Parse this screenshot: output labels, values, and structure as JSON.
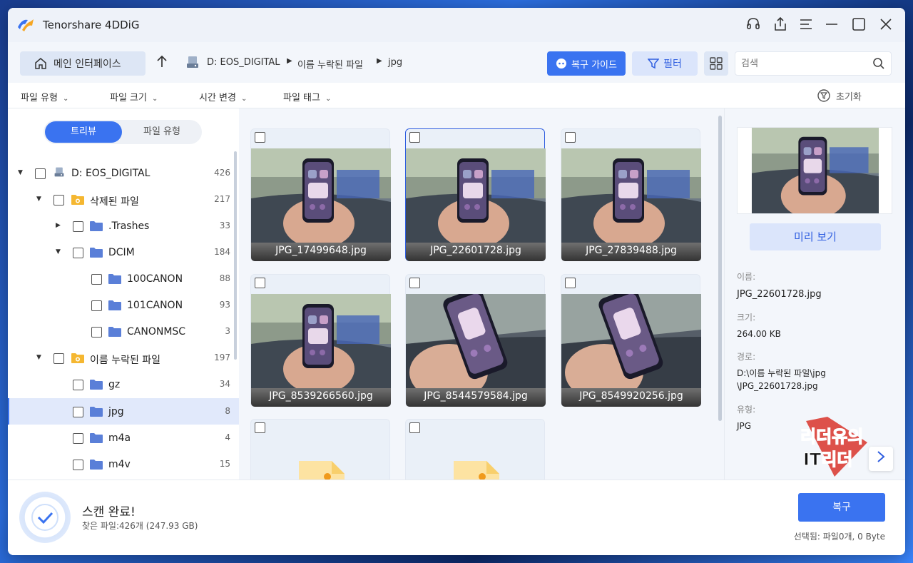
{
  "app": {
    "title": "Tenorshare 4DDiG"
  },
  "nav": {
    "home_label": "메인 인터페이스",
    "breadcrumb": [
      "D: EOS_DIGITAL",
      "이름 누락된 파일",
      "jpg"
    ],
    "guide_label": "복구 가이드",
    "filter_label": "필터",
    "search_placeholder": "검색"
  },
  "filters": {
    "items": [
      "파일 유형",
      "파일 크기",
      "시간 변경",
      "파일 태그"
    ],
    "reset_label": "초기화"
  },
  "sidebar": {
    "tabs": {
      "tree": "트리뷰",
      "type": "파일 유형"
    },
    "tree": [
      {
        "label": "D: EOS_DIGITAL",
        "count": "426"
      },
      {
        "label": "삭제된 파일",
        "count": "217"
      },
      {
        "label": ".Trashes",
        "count": "33"
      },
      {
        "label": "DCIM",
        "count": "184"
      },
      {
        "label": "100CANON",
        "count": "88"
      },
      {
        "label": "101CANON",
        "count": "93"
      },
      {
        "label": "CANONMSC",
        "count": "3"
      },
      {
        "label": "이름 누락된 파일",
        "count": "197"
      },
      {
        "label": "gz",
        "count": "34"
      },
      {
        "label": "jpg",
        "count": "8"
      },
      {
        "label": "m4a",
        "count": "4"
      },
      {
        "label": "m4v",
        "count": "15"
      }
    ]
  },
  "grid": {
    "files": [
      {
        "name": "JPG_17499648.jpg"
      },
      {
        "name": "JPG_22601728.jpg"
      },
      {
        "name": "JPG_27839488.jpg"
      },
      {
        "name": "JPG_8539266560.jpg"
      },
      {
        "name": "JPG_8544579584.jpg"
      },
      {
        "name": "JPG_8549920256.jpg"
      }
    ]
  },
  "details": {
    "preview_label": "미리 보기",
    "name_label": "이름:",
    "name_value": "JPG_22601728.jpg",
    "size_label": "크기:",
    "size_value": "264.00 KB",
    "path_label": "경로:",
    "path_line1": "D:\\이름 누락된 파일\\jpg",
    "path_line2": "\\JPG_22601728.jpg",
    "type_label": "유형:",
    "type_value": "JPG",
    "watermark_text": "리더유의 IT리더"
  },
  "status": {
    "title": "스캔 완료!",
    "subtitle": "찾은 파일:426개 (247.93 GB)",
    "recover_label": "복구",
    "selected_info": "선택됨: 파일0개, 0 Byte"
  },
  "colors": {
    "accent": "#3a73f0",
    "folder_yellow": "#f5b731",
    "folder_blue": "#5a7fd8"
  }
}
